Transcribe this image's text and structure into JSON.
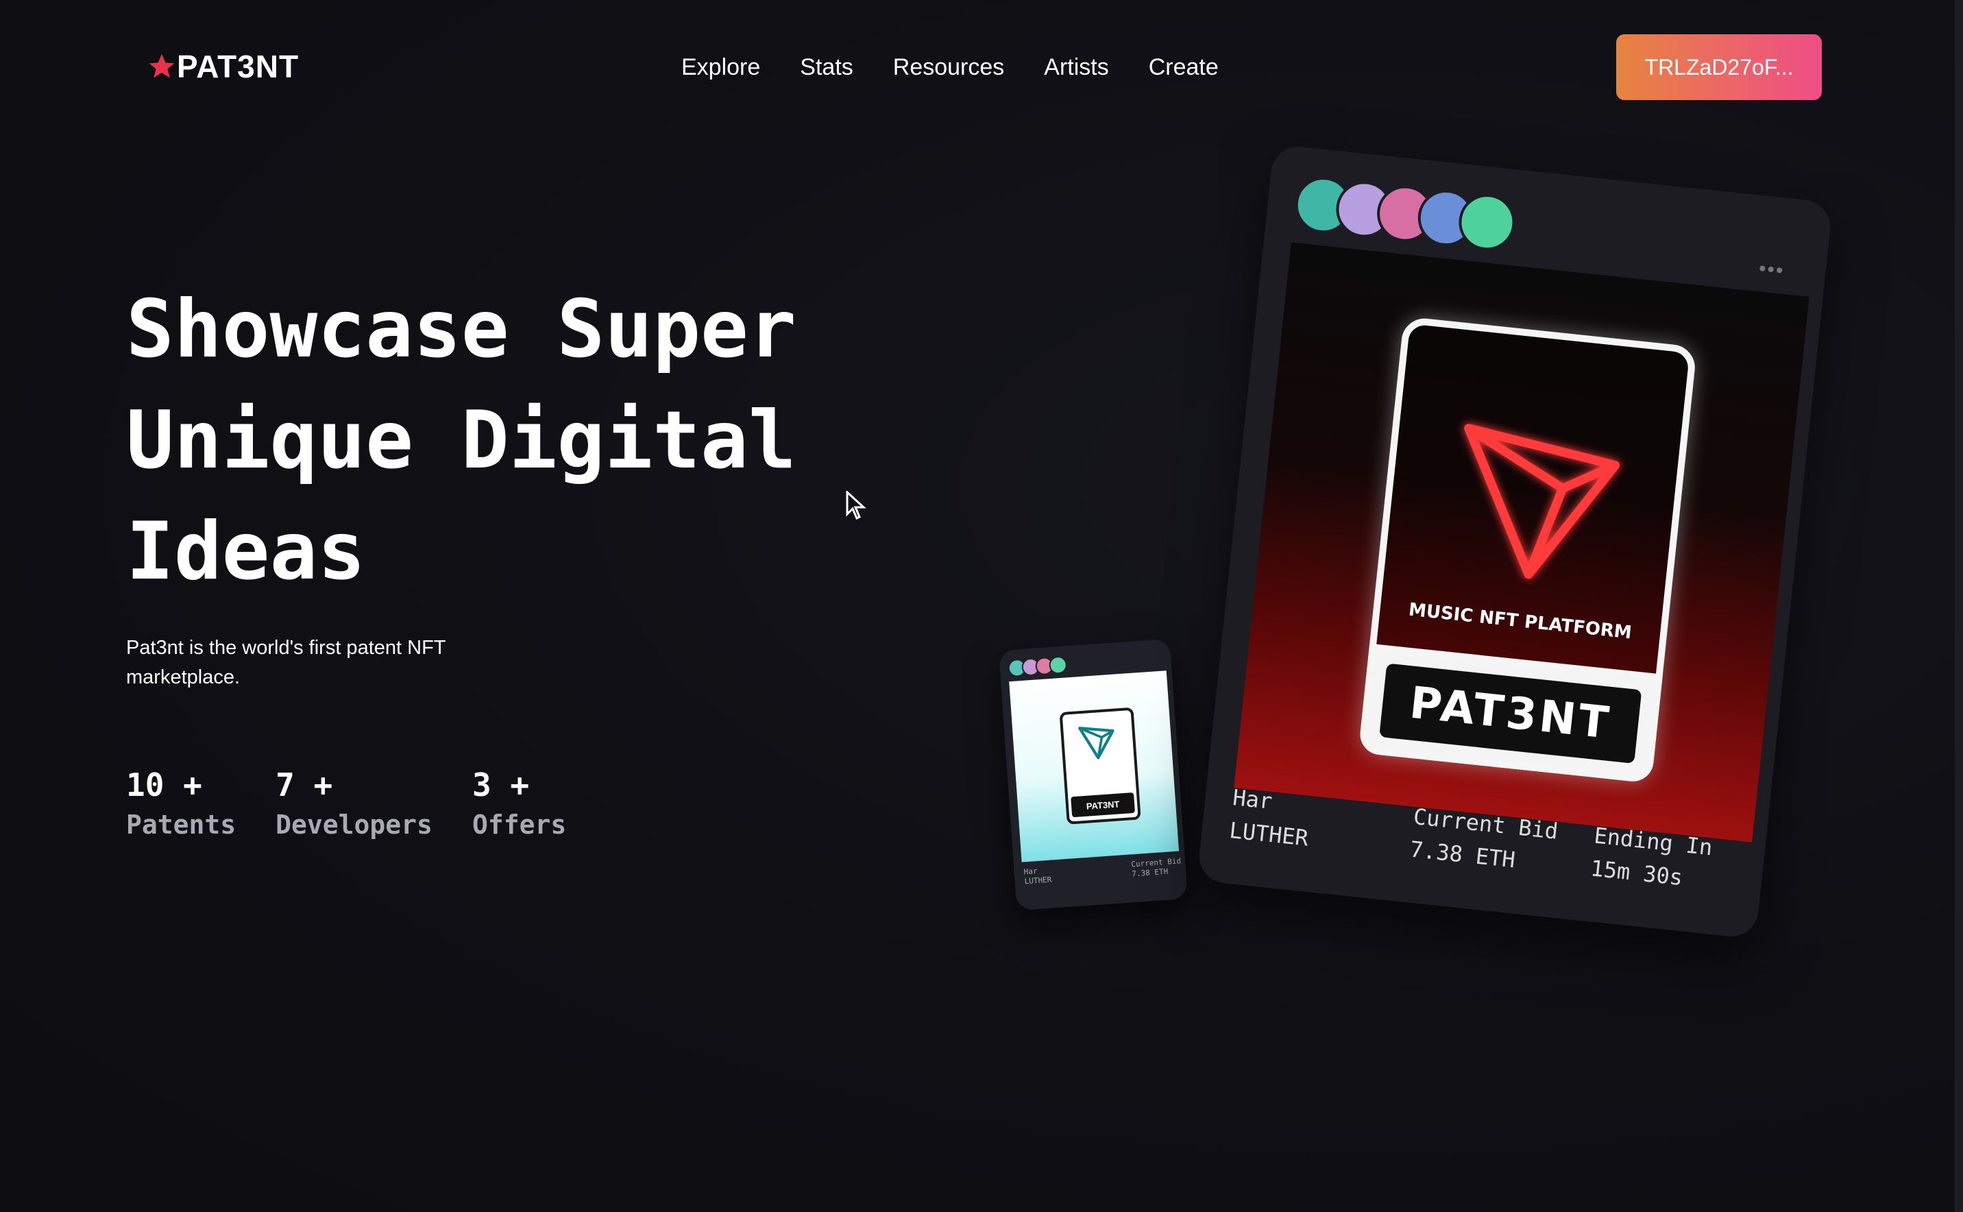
{
  "header": {
    "logo_text": "PAT3NT",
    "nav": [
      "Explore",
      "Stats",
      "Resources",
      "Artists",
      "Create"
    ],
    "wallet_label": "TRLZaD27oF..."
  },
  "hero": {
    "title_lines": [
      "Showcase Super",
      "Unique Digital",
      "Ideas"
    ],
    "subtitle": "Pat3nt is the world's first patent NFT marketplace."
  },
  "stats": [
    {
      "value": "10 +",
      "label": "Patents"
    },
    {
      "value": "7 +",
      "label": "Developers"
    },
    {
      "value": "3 +",
      "label": "Offers"
    }
  ],
  "featured_card": {
    "art_caption": "MUSIC NFT PLATFORM",
    "art_brand": "PAT3NT",
    "artist_first": "Har",
    "artist_last": "LUTHER",
    "bid_label": "Current Bid",
    "bid_value": "7.38 ETH",
    "ending_label": "Ending In",
    "ending_value": "15m 30s",
    "menu_icon": "more-dots-icon"
  },
  "small_card": {
    "art_brand": "PAT3NT",
    "artist_first": "Har",
    "artist_last": "LUTHER",
    "bid_label": "Current Bid",
    "bid_value": "7.38 ETH"
  },
  "colors": {
    "background": "#0f0f14",
    "wallet_gradient_start": "#e7843f",
    "wallet_gradient_end": "#ef4d87",
    "logo_star": "#e8334a",
    "stat_label": "#a9a9b2"
  }
}
